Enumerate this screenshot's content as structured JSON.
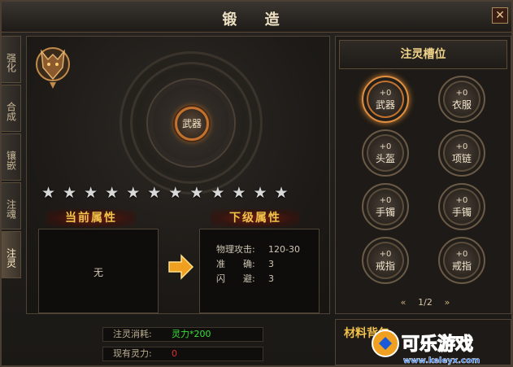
{
  "window": {
    "title": "锻 造",
    "close": "✕"
  },
  "tabs": [
    "强化",
    "合成",
    "镶嵌",
    "注魂",
    "注灵"
  ],
  "active_tab": 4,
  "center": {
    "weapon_label": "武器",
    "star_count": 12,
    "star_glyph": "★"
  },
  "attributes": {
    "current_title": "当前属性",
    "next_title": "下级属性",
    "current_value": "无",
    "next": [
      {
        "k": "物理攻击:",
        "v": "120-30"
      },
      {
        "k": "准　　确:",
        "v": "3"
      },
      {
        "k": "闪　　避:",
        "v": "3"
      }
    ]
  },
  "cost": {
    "label": "注灵消耗:",
    "value": "灵力*200",
    "value_color": "#38e038",
    "own_label": "现有灵力:",
    "own_value": "0",
    "own_color": "#e03030"
  },
  "slots_panel": {
    "title": "注灵槽位",
    "slots": [
      {
        "plus": "+0",
        "name": "武器"
      },
      {
        "plus": "+0",
        "name": "衣服"
      },
      {
        "plus": "+0",
        "name": "头盔"
      },
      {
        "plus": "+0",
        "name": "项链"
      },
      {
        "plus": "+0",
        "name": "手镯"
      },
      {
        "plus": "+0",
        "name": "手镯"
      },
      {
        "plus": "+0",
        "name": "戒指"
      },
      {
        "plus": "+0",
        "name": "戒指"
      }
    ],
    "page": "1/2"
  },
  "materials": {
    "title": "材料背包"
  },
  "watermark": {
    "brand": "可乐游戏",
    "url": "www.keleyx.com"
  }
}
